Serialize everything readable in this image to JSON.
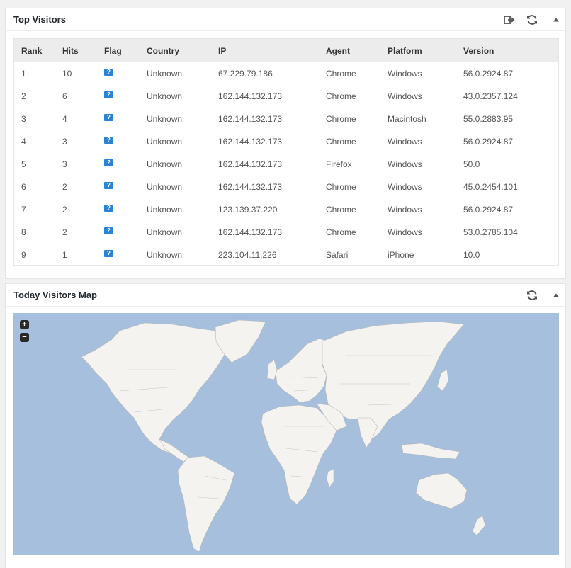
{
  "top_visitors": {
    "title": "Top Visitors",
    "columns": [
      "Rank",
      "Hits",
      "Flag",
      "Country",
      "IP",
      "Agent",
      "Platform",
      "Version"
    ],
    "rows": [
      {
        "rank": "1",
        "hits": "10",
        "flag": "?",
        "country": "Unknown",
        "ip": "67.229.79.186",
        "agent": "Chrome",
        "platform": "Windows",
        "version": "56.0.2924.87"
      },
      {
        "rank": "2",
        "hits": "6",
        "flag": "?",
        "country": "Unknown",
        "ip": "162.144.132.173",
        "agent": "Chrome",
        "platform": "Windows",
        "version": "43.0.2357.124"
      },
      {
        "rank": "3",
        "hits": "4",
        "flag": "?",
        "country": "Unknown",
        "ip": "162.144.132.173",
        "agent": "Chrome",
        "platform": "Macintosh",
        "version": "55.0.2883.95"
      },
      {
        "rank": "4",
        "hits": "3",
        "flag": "?",
        "country": "Unknown",
        "ip": "162.144.132.173",
        "agent": "Chrome",
        "platform": "Windows",
        "version": "56.0.2924.87"
      },
      {
        "rank": "5",
        "hits": "3",
        "flag": "?",
        "country": "Unknown",
        "ip": "162.144.132.173",
        "agent": "Firefox",
        "platform": "Windows",
        "version": "50.0"
      },
      {
        "rank": "6",
        "hits": "2",
        "flag": "?",
        "country": "Unknown",
        "ip": "162.144.132.173",
        "agent": "Chrome",
        "platform": "Windows",
        "version": "45.0.2454.101"
      },
      {
        "rank": "7",
        "hits": "2",
        "flag": "?",
        "country": "Unknown",
        "ip": "123.139.37.220",
        "agent": "Chrome",
        "platform": "Windows",
        "version": "56.0.2924.87"
      },
      {
        "rank": "8",
        "hits": "2",
        "flag": "?",
        "country": "Unknown",
        "ip": "162.144.132.173",
        "agent": "Chrome",
        "platform": "Windows",
        "version": "53.0.2785.104"
      },
      {
        "rank": "9",
        "hits": "1",
        "flag": "?",
        "country": "Unknown",
        "ip": "223.104.11.226",
        "agent": "Safari",
        "platform": "iPhone",
        "version": "10.0"
      }
    ],
    "controls": {
      "export_icon": "export-icon",
      "refresh_icon": "refresh-icon",
      "collapse_icon": "collapse-triangle-icon"
    }
  },
  "visitors_map": {
    "title": "Today Visitors Map",
    "zoom_in": "+",
    "zoom_out": "−",
    "ocean_color": "#a5bfdd",
    "land_color": "#f4f3f0",
    "controls": {
      "refresh_icon": "refresh-icon",
      "collapse_icon": "collapse-triangle-icon"
    }
  }
}
